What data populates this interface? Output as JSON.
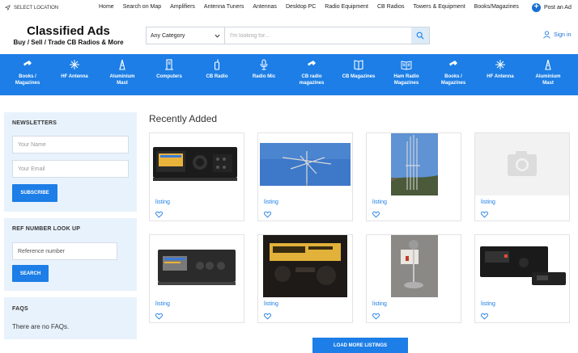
{
  "topbar": {
    "location_label": "SELECT LOCATION",
    "nav": [
      "Home",
      "Search on Map",
      "Amplifiers",
      "Antenna Tuners",
      "Antennas",
      "Desktop PC",
      "Radio Equipment",
      "CB Radios",
      "Towers & Equipment",
      "Books/Magazines"
    ],
    "post_label": "Post an Ad"
  },
  "header": {
    "logo_title": "Classified Ads",
    "logo_tagline": "Buy / Sell / Trade CB Radios & More",
    "category_select": "Any Category",
    "search_placeholder": "I'm looking for...",
    "signin_label": "Sign in"
  },
  "categories": [
    {
      "label1": "Books /",
      "label2": "Magazines",
      "icon": "radio-icon"
    },
    {
      "label1": "HF Antenna",
      "label2": "",
      "icon": "antenna-icon"
    },
    {
      "label1": "Aluminium",
      "label2": "Mast",
      "icon": "mast-icon"
    },
    {
      "label1": "Computers",
      "label2": "",
      "icon": "tower-icon"
    },
    {
      "label1": "CB Radio",
      "label2": "",
      "icon": "walkie-icon"
    },
    {
      "label1": "Radio Mic",
      "label2": "",
      "icon": "mic-icon"
    },
    {
      "label1": "CB radio",
      "label2": "magazines",
      "icon": "radio-icon"
    },
    {
      "label1": "CB Magazines",
      "label2": "",
      "icon": "book-icon"
    },
    {
      "label1": "Ham Radio",
      "label2": "Magazines",
      "icon": "book-open-icon"
    },
    {
      "label1": "Books /",
      "label2": "Magazines",
      "icon": "radio-icon"
    },
    {
      "label1": "HF Antenna",
      "label2": "",
      "icon": "antenna-icon"
    },
    {
      "label1": "Aluminium",
      "label2": "Mast",
      "icon": "mast-icon"
    }
  ],
  "sidebar": {
    "newsletters": {
      "title": "NEWSLETTERS",
      "name_placeholder": "Your Name",
      "email_placeholder": "Your Email",
      "button": "SUBSCRIBE"
    },
    "ref_lookup": {
      "title": "REF NUMBER LOOK UP",
      "placeholder": "Reference number",
      "button": "SEARCH"
    },
    "faqs": {
      "title": "FAQS",
      "text": "There are no FAQs."
    }
  },
  "main": {
    "heading": "Recently Added",
    "listings": [
      {
        "label": "listing",
        "image": "radio-transceiver"
      },
      {
        "label": "listing",
        "image": "antenna-sky"
      },
      {
        "label": "listing",
        "image": "vertical-antenna"
      },
      {
        "label": "listing",
        "image": "placeholder-camera"
      },
      {
        "label": "listing",
        "image": "amplifier"
      },
      {
        "label": "listing",
        "image": "radio-display"
      },
      {
        "label": "listing",
        "image": "desk-microphone"
      },
      {
        "label": "listing",
        "image": "transceiver-black"
      }
    ],
    "load_more": "LOAD MORE LISTINGS"
  }
}
